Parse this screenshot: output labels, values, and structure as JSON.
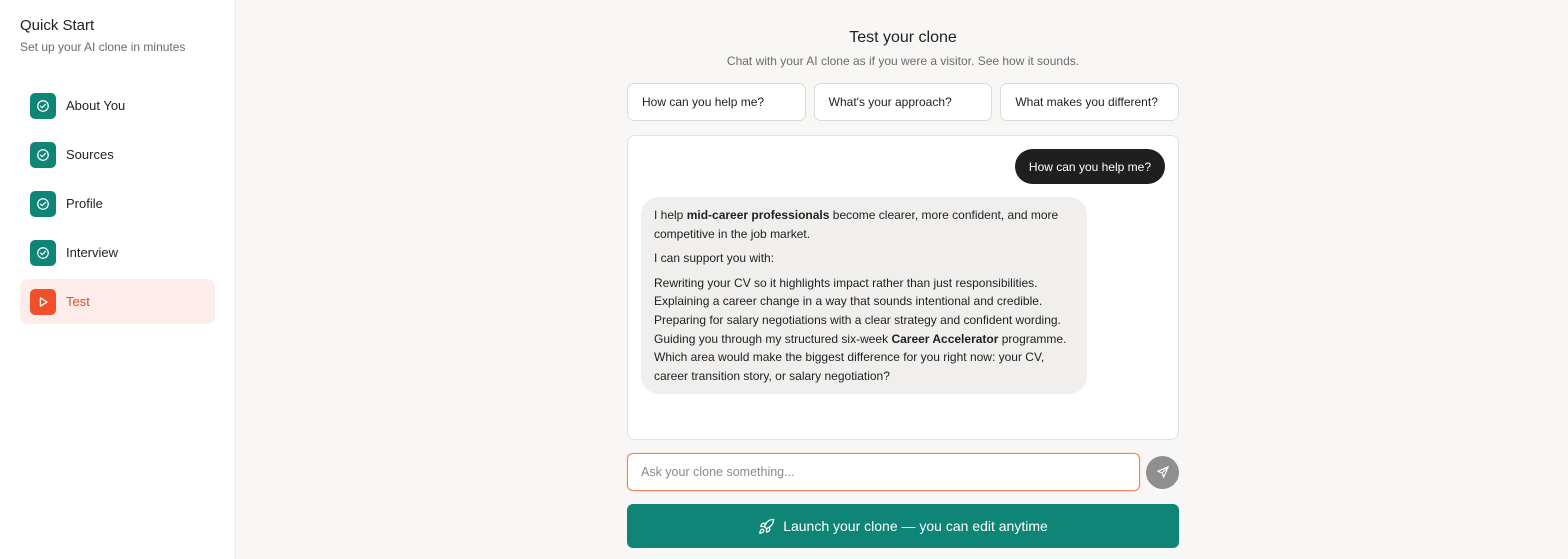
{
  "sidebar": {
    "title": "Quick Start",
    "subtitle": "Set up your AI clone in minutes",
    "steps": [
      {
        "label": "About You",
        "icon": "check-circle-icon",
        "status": "complete"
      },
      {
        "label": "Sources",
        "icon": "check-circle-icon",
        "status": "complete"
      },
      {
        "label": "Profile",
        "icon": "check-circle-icon",
        "status": "complete"
      },
      {
        "label": "Interview",
        "icon": "check-circle-icon",
        "status": "complete"
      },
      {
        "label": "Test",
        "icon": "play-icon",
        "status": "active"
      }
    ]
  },
  "main": {
    "title": "Test your clone",
    "subtitle": "Chat with your AI clone as if you were a visitor. See how it sounds.",
    "suggestions": [
      "How can you help me?",
      "What's your approach?",
      "What makes you different?"
    ],
    "chat": {
      "user_message": "How can you help me?",
      "bot": {
        "p1_a": "I help ",
        "p1_bold": "mid-career professionals",
        "p1_b": " become clearer, more confident, and more competitive in the job market.",
        "p2": "I can support you with:",
        "line1": "Rewriting your CV so it highlights impact rather than just responsibilities.",
        "line2": "Explaining a career change in a way that sounds intentional and credible.",
        "line3": "Preparing for salary negotiations with a clear strategy and confident wording.",
        "line4_a": "Guiding you through my structured six-week ",
        "line4_bold": "Career Accelerator",
        "line4_b": " programme.",
        "line5": "Which area would make the biggest difference for you right now: your CV, career transition story, or salary negotiation?"
      }
    },
    "input": {
      "placeholder": "Ask your clone something...",
      "value": ""
    },
    "launch_label": "Launch your clone — you can edit anytime"
  },
  "colors": {
    "accent": "#0f8577",
    "active": "#f0502a",
    "active_bg": "#fdecea"
  }
}
